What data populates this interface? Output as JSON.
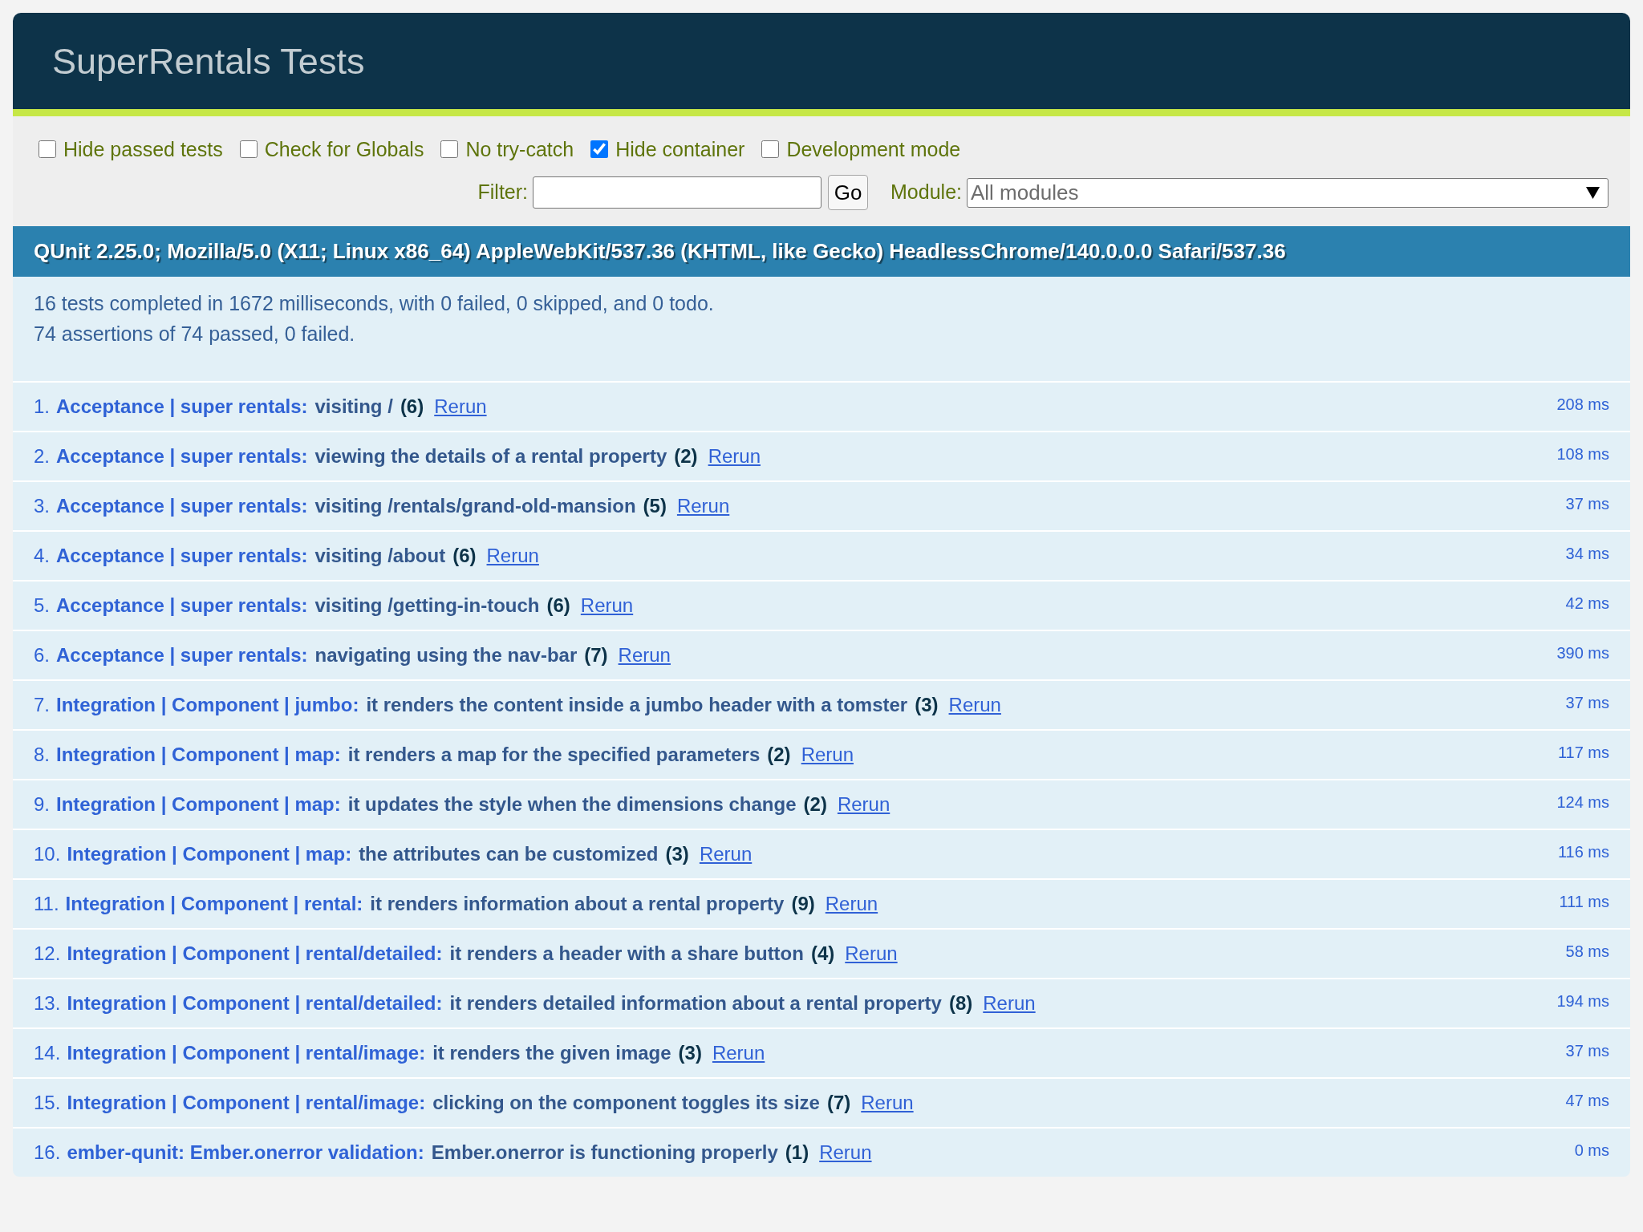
{
  "header": {
    "title": "SuperRentals Tests"
  },
  "banner": {
    "passed": true
  },
  "toolbar": {
    "options": [
      {
        "label": "Hide passed tests",
        "checked": false
      },
      {
        "label": "Check for Globals",
        "checked": false
      },
      {
        "label": "No try-catch",
        "checked": false
      },
      {
        "label": "Hide container",
        "checked": true
      },
      {
        "label": "Development mode",
        "checked": false
      }
    ],
    "filter": {
      "label": "Filter:"
    },
    "go_button": {
      "label": "Go"
    },
    "module": {
      "label": "Module:",
      "value": "All modules"
    }
  },
  "user_agent": "QUnit 2.25.0; Mozilla/5.0 (X11; Linux x86_64) AppleWebKit/537.36 (KHTML, like Gecko) HeadlessChrome/140.0.0.0 Safari/537.36",
  "summary": {
    "lines": [
      "16 tests completed in 1672 milliseconds, with 0 failed, 0 skipped, and 0 todo.",
      "74 assertions of 74 passed, 0 failed."
    ]
  },
  "tests": [
    {
      "number": "1.",
      "module": "Acceptance | super rentals:",
      "name": "visiting /",
      "count": "(6)",
      "rerun": "Rerun",
      "runtime": "208 ms",
      "passed": true
    },
    {
      "number": "2.",
      "module": "Acceptance | super rentals:",
      "name": "viewing the details of a rental property",
      "count": "(2)",
      "rerun": "Rerun",
      "runtime": "108 ms",
      "passed": true
    },
    {
      "number": "3.",
      "module": "Acceptance | super rentals:",
      "name": "visiting /rentals/grand-old-mansion",
      "count": "(5)",
      "rerun": "Rerun",
      "runtime": "37 ms",
      "passed": true
    },
    {
      "number": "4.",
      "module": "Acceptance | super rentals:",
      "name": "visiting /about",
      "count": "(6)",
      "rerun": "Rerun",
      "runtime": "34 ms",
      "passed": true
    },
    {
      "number": "5.",
      "module": "Acceptance | super rentals:",
      "name": "visiting /getting-in-touch",
      "count": "(6)",
      "rerun": "Rerun",
      "runtime": "42 ms",
      "passed": true
    },
    {
      "number": "6.",
      "module": "Acceptance | super rentals:",
      "name": "navigating using the nav-bar",
      "count": "(7)",
      "rerun": "Rerun",
      "runtime": "390 ms",
      "passed": true
    },
    {
      "number": "7.",
      "module": "Integration | Component | jumbo:",
      "name": "it renders the content inside a jumbo header with a tomster",
      "count": "(3)",
      "rerun": "Rerun",
      "runtime": "37 ms",
      "passed": true
    },
    {
      "number": "8.",
      "module": "Integration | Component | map:",
      "name": "it renders a map for the specified parameters",
      "count": "(2)",
      "rerun": "Rerun",
      "runtime": "117 ms",
      "passed": true
    },
    {
      "number": "9.",
      "module": "Integration | Component | map:",
      "name": "it updates the style when the dimensions change",
      "count": "(2)",
      "rerun": "Rerun",
      "runtime": "124 ms",
      "passed": true
    },
    {
      "number": "10.",
      "module": "Integration | Component | map:",
      "name": "the attributes can be customized",
      "count": "(3)",
      "rerun": "Rerun",
      "runtime": "116 ms",
      "passed": true
    },
    {
      "number": "11.",
      "module": "Integration | Component | rental:",
      "name": "it renders information about a rental property",
      "count": "(9)",
      "rerun": "Rerun",
      "runtime": "111 ms",
      "passed": true
    },
    {
      "number": "12.",
      "module": "Integration | Component | rental/detailed:",
      "name": "it renders a header with a share button",
      "count": "(4)",
      "rerun": "Rerun",
      "runtime": "58 ms",
      "passed": true
    },
    {
      "number": "13.",
      "module": "Integration | Component | rental/detailed:",
      "name": "it renders detailed information about a rental property",
      "count": "(8)",
      "rerun": "Rerun",
      "runtime": "194 ms",
      "passed": true
    },
    {
      "number": "14.",
      "module": "Integration | Component | rental/image:",
      "name": "it renders the given image",
      "count": "(3)",
      "rerun": "Rerun",
      "runtime": "37 ms",
      "passed": true
    },
    {
      "number": "15.",
      "module": "Integration | Component | rental/image:",
      "name": "clicking on the component toggles its size",
      "count": "(7)",
      "rerun": "Rerun",
      "runtime": "47 ms",
      "passed": true
    },
    {
      "number": "16.",
      "module": "ember-qunit: Ember.onerror validation:",
      "name": "Ember.onerror is functioning properly",
      "count": "(1)",
      "rerun": "Rerun",
      "runtime": "0 ms",
      "passed": true
    }
  ]
}
